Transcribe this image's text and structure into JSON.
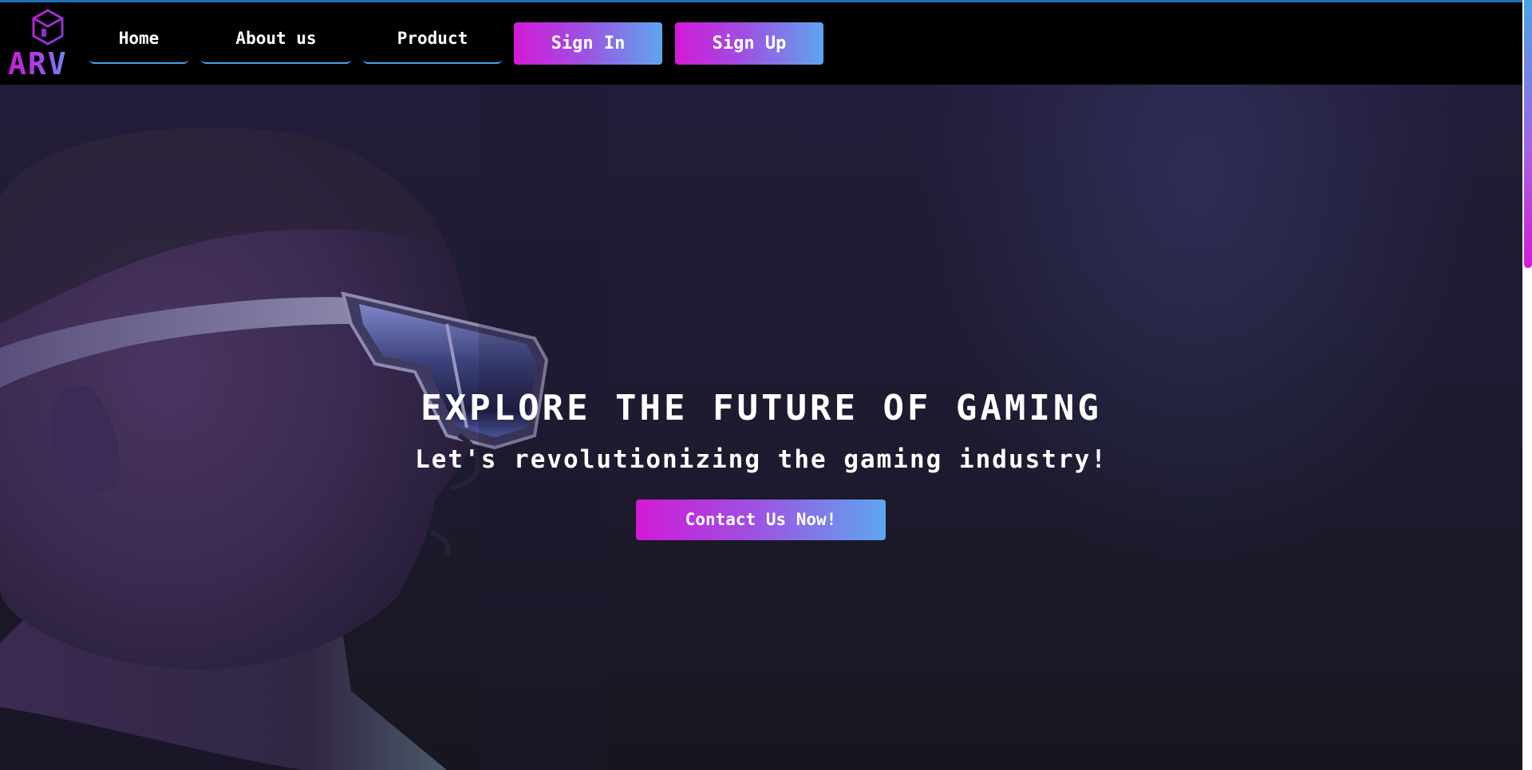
{
  "brand": {
    "logo_text": "ARV",
    "logo_icon": "cube-icon"
  },
  "nav": {
    "items": [
      {
        "label": "Home"
      },
      {
        "label": "About us"
      },
      {
        "label": "Product"
      }
    ],
    "sign_in_label": "Sign In",
    "sign_up_label": "Sign Up"
  },
  "hero": {
    "title": "EXPLORE THE FUTURE OF GAMING",
    "subtitle": "Let's revolutionizing the gaming industry!",
    "cta_label": "Contact Us Now!"
  },
  "colors": {
    "accent_start": "#d21ad6",
    "accent_end": "#5ea6ee",
    "nav_underline": "#4aa3e8",
    "navbar_bg": "#000000"
  }
}
